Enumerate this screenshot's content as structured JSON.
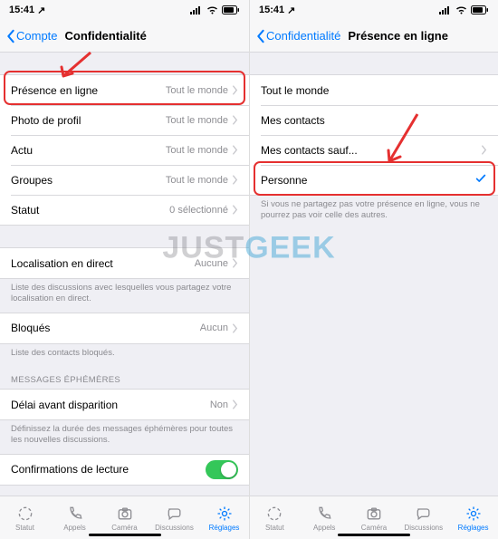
{
  "status": {
    "time": "15:41",
    "loc_glyph": "↗"
  },
  "left": {
    "back": "Compte",
    "title": "Confidentialité",
    "rows": {
      "presence": {
        "label": "Présence en ligne",
        "value": "Tout le monde"
      },
      "photo": {
        "label": "Photo de profil",
        "value": "Tout le monde"
      },
      "actu": {
        "label": "Actu",
        "value": "Tout le monde"
      },
      "groups": {
        "label": "Groupes",
        "value": "Tout le monde"
      },
      "status": {
        "label": "Statut",
        "value": "0 sélectionné"
      },
      "liveloc": {
        "label": "Localisation en direct",
        "value": "Aucune"
      },
      "blocked": {
        "label": "Bloqués",
        "value": "Aucun"
      },
      "eph_header": "Messages éphémères",
      "timer": {
        "label": "Délai avant disparition",
        "value": "Non"
      },
      "read": {
        "label": "Confirmations de lecture"
      }
    },
    "footers": {
      "liveloc": "Liste des discussions avec lesquelles vous partagez votre localisation en direct.",
      "blocked": "Liste des contacts bloqués.",
      "timer": "Définissez la durée des messages éphémères pour toutes les nouvelles discussions."
    }
  },
  "right": {
    "back": "Confidentialité",
    "title": "Présence en ligne",
    "options": {
      "everyone": "Tout le monde",
      "contacts": "Mes contacts",
      "except": "Mes contacts sauf...",
      "nobody": "Personne"
    },
    "footer": "Si vous ne partagez pas votre présence en ligne, vous ne pourrez pas voir celle des autres."
  },
  "tabs": {
    "status": "Statut",
    "calls": "Appels",
    "camera": "Caméra",
    "chats": "Discussions",
    "settings": "Réglages"
  },
  "watermark": {
    "a": "JUST",
    "b": "GEEK"
  }
}
